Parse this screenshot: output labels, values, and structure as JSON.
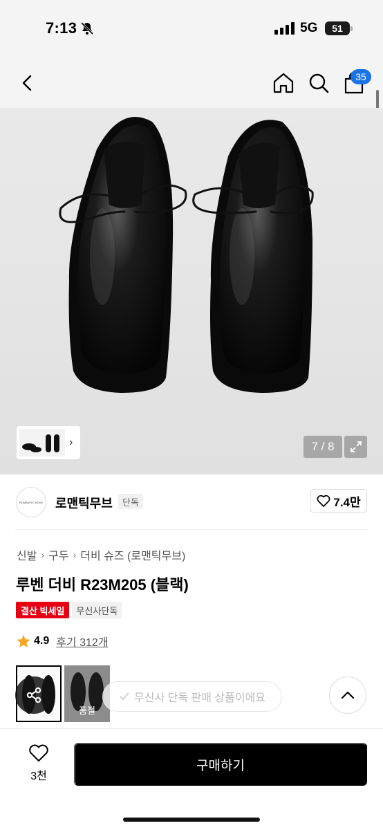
{
  "status_bar": {
    "time": "7:13",
    "network": "5G",
    "battery": "51"
  },
  "header": {
    "cart_count": "35"
  },
  "gallery": {
    "counter": "7 / 8"
  },
  "brand": {
    "logo_text": "ROMANTIC MOVE",
    "name": "로맨틱무브",
    "tag": "단독",
    "likes": "7.4만"
  },
  "breadcrumb": [
    "신발",
    "구두",
    "더비 슈즈 (로맨틱무브)"
  ],
  "product": {
    "title": "루벤 더비 R23M205 (블랙)",
    "badge_sale": "결산 빅세일",
    "badge_exclusive": "무신사단독",
    "rating": "4.9",
    "reviews": "후기 312개"
  },
  "options": {
    "soldout_label": "품절"
  },
  "exclusive_notice": "무신사 단독 판매 상품이에요",
  "bottom": {
    "wish_count": "3천",
    "buy_label": "구매하기"
  },
  "colors": {
    "sale_red": "#e60012",
    "badge_blue": "#1a73e8",
    "buy_black": "#000000"
  },
  "icons": [
    "bell-off-icon",
    "signal-icon",
    "battery-icon",
    "back-icon",
    "home-icon",
    "search-icon",
    "cart-icon",
    "expand-icon",
    "heart-icon",
    "star-icon",
    "share-icon",
    "check-icon",
    "chevron-up-icon"
  ]
}
